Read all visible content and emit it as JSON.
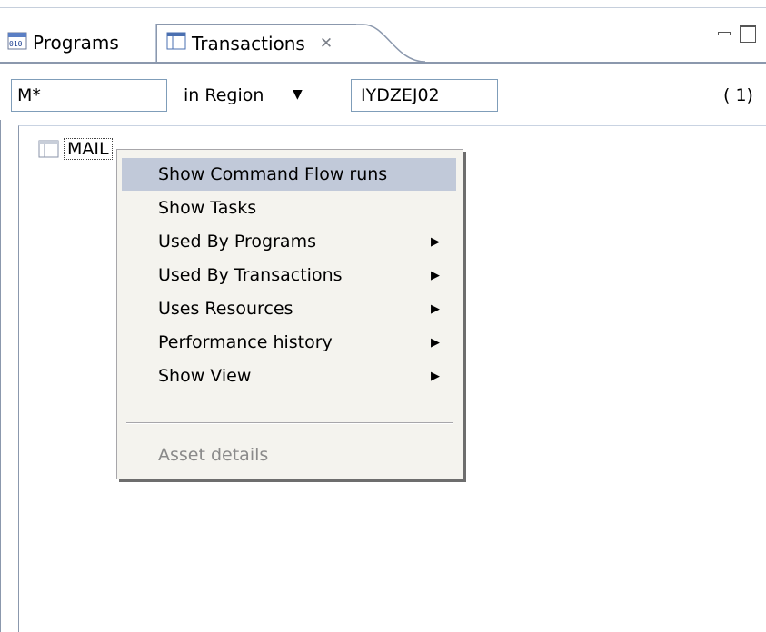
{
  "tabs": [
    {
      "label": "Programs",
      "icon": "binary-program-icon",
      "active": false
    },
    {
      "label": "Transactions",
      "icon": "table-icon",
      "active": true
    }
  ],
  "filter": {
    "pattern_value": "M*",
    "scope_label": "in Region",
    "region_value": "IYDZEJ02",
    "count": "( 1)"
  },
  "tree": {
    "items": [
      {
        "label": "MAIL",
        "icon": "table-icon"
      }
    ]
  },
  "context_menu": {
    "items": [
      {
        "label": "Show Command Flow runs",
        "highlighted": true,
        "submenu": false,
        "enabled": true
      },
      {
        "label": "Show Tasks",
        "submenu": false,
        "enabled": true
      },
      {
        "label": "Used By Programs",
        "submenu": true,
        "enabled": true
      },
      {
        "label": "Used By Transactions",
        "submenu": true,
        "enabled": true
      },
      {
        "label": "Uses Resources",
        "submenu": true,
        "enabled": true
      },
      {
        "label": "Performance history",
        "submenu": true,
        "enabled": true
      },
      {
        "label": "Show View",
        "submenu": true,
        "enabled": true
      },
      {
        "label": "Asset details",
        "submenu": false,
        "enabled": false
      }
    ]
  },
  "colors": {
    "menu_highlight": "#c1c9d9",
    "menu_background": "#f4f3ee",
    "disabled_text": "#8a8a8a",
    "border_blue": "#8b98ad"
  }
}
